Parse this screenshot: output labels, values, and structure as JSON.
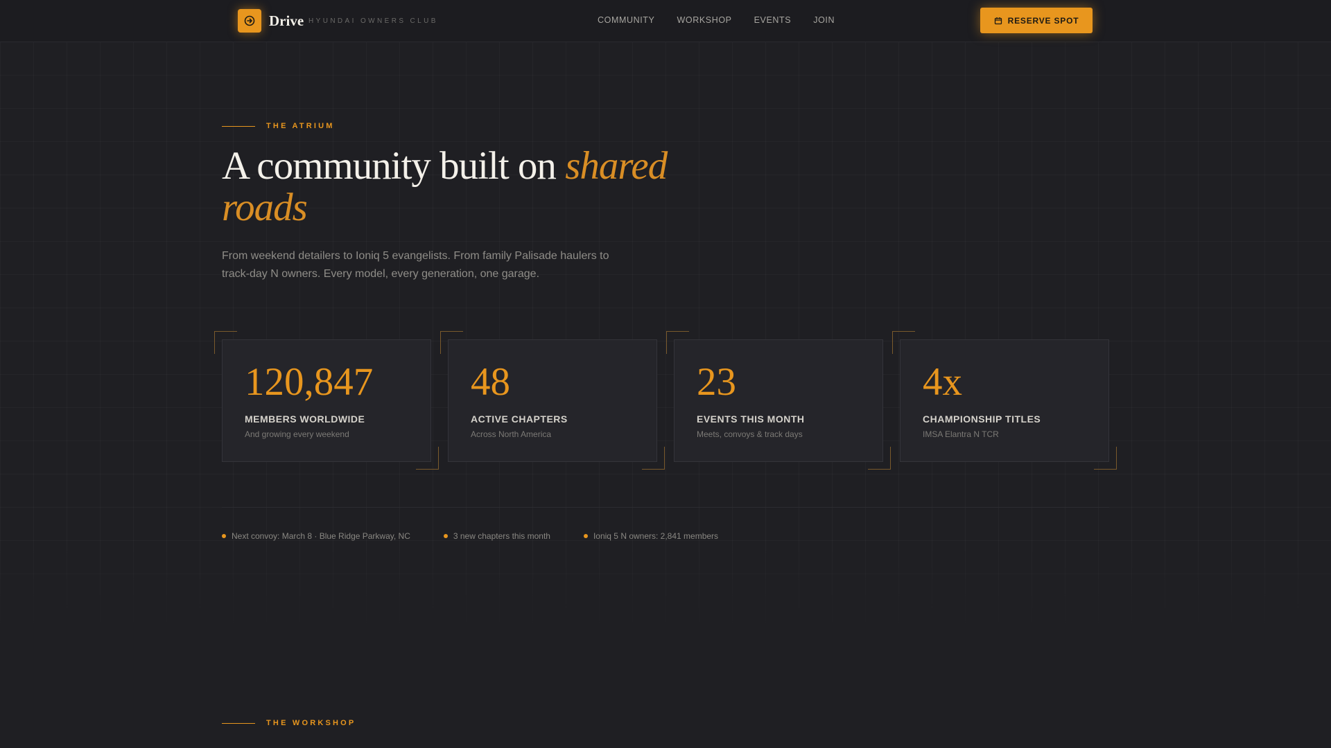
{
  "header": {
    "brand_name": "Drive",
    "brand_tagline": "HYUNDAI OWNERS CLUB",
    "logo_icon": "arrow-circle-right-icon",
    "nav": [
      {
        "label": "COMMUNITY"
      },
      {
        "label": "WORKSHOP"
      },
      {
        "label": "EVENTS"
      },
      {
        "label": "JOIN"
      }
    ],
    "cta_label": "RESERVE SPOT",
    "cta_icon": "calendar-icon"
  },
  "hero": {
    "eyebrow": "THE ATRIUM",
    "title_plain": "A community built on ",
    "title_accent": "shared roads",
    "subtitle": "From weekend detailers to Ioniq 5 evangelists. From family Palisade haulers to track-day N owners. Every model, every generation, one garage."
  },
  "stats": [
    {
      "value": "120,847",
      "label": "MEMBERS WORLDWIDE",
      "caption": "And growing every weekend"
    },
    {
      "value": "48",
      "label": "ACTIVE CHAPTERS",
      "caption": "Across North America"
    },
    {
      "value": "23",
      "label": "EVENTS THIS MONTH",
      "caption": "Meets, convoys & track days"
    },
    {
      "value": "4x",
      "label": "CHAMPIONSHIP TITLES",
      "caption": "IMSA Elantra N TCR"
    }
  ],
  "ticker": [
    {
      "text": "Next convoy: March 8 · Blue Ridge Parkway, NC"
    },
    {
      "text": "3 new chapters this month"
    },
    {
      "text": "Ioniq 5 N owners: 2,841 members"
    }
  ],
  "next_section": {
    "eyebrow": "THE WORKSHOP"
  },
  "colors": {
    "accent": "#e8961e",
    "background": "#1f1f23",
    "card": "#25252a"
  }
}
